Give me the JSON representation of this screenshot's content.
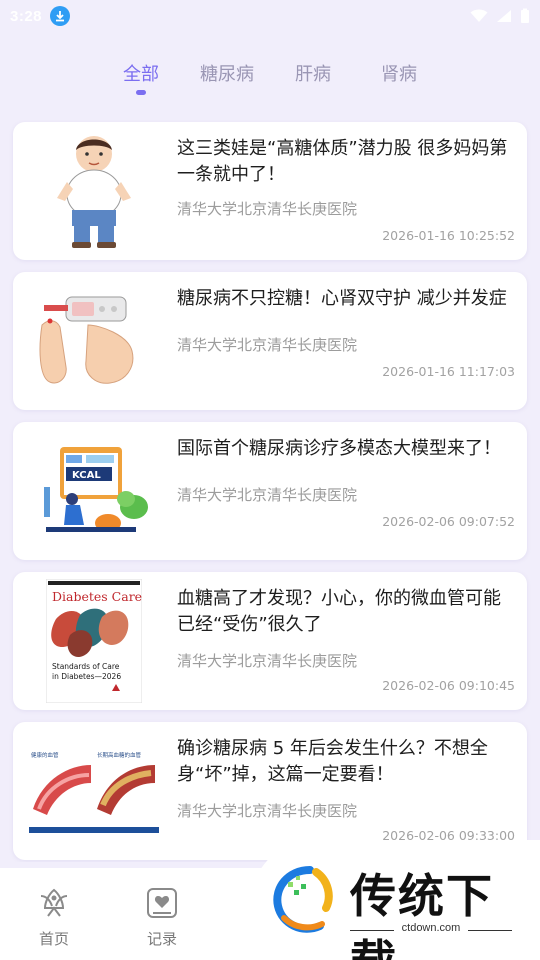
{
  "status_bar": {
    "time": "3:28"
  },
  "tabs": [
    {
      "label": "全部",
      "active": true
    },
    {
      "label": "糖尿病",
      "active": false
    },
    {
      "label": "肝病",
      "active": false
    },
    {
      "label": "肾病",
      "active": false
    }
  ],
  "articles": [
    {
      "title": "这三类娃是“高糖体质”潜力股 很多妈妈第一条就中了！",
      "source": "清华大学北京清华长庚医院",
      "time": "2026-01-16 10:25:52"
    },
    {
      "title": "糖尿病不只控糖！心肾双守护 减少并发症",
      "source": "清华大学北京清华长庚医院",
      "time": "2026-01-16 11:17:03"
    },
    {
      "title": "国际首个糖尿病诊疗多模态大模型来了！",
      "source": "清华大学北京清华长庚医院",
      "time": "2026-02-06 09:07:52"
    },
    {
      "title": "血糖高了才发现？小心，你的微血管可能已经“受伤”很久了",
      "source": "清华大学北京清华长庚医院",
      "time": "2026-02-06 09:10:45"
    },
    {
      "title": "确诊糖尿病 5 年后会发生什么？不想全身“坏”掉，这篇一定要看！",
      "source": "清华大学北京清华长庚医院",
      "time": "2026-02-06 09:33:00"
    }
  ],
  "thumbs": {
    "kcal": "KCAL",
    "journal_name": "Diabetes Care",
    "journal_sub1": "Standards of Care",
    "journal_sub2": "in Diabetes—2026",
    "vessel_left": "健康的血管",
    "vessel_right": "长期高血糖的血管"
  },
  "bottom_nav": [
    {
      "label": "首页",
      "icon": "home-icon"
    },
    {
      "label": "记录",
      "icon": "record-icon"
    }
  ],
  "watermark": {
    "text": "传统下载",
    "url": "ctdown.com"
  },
  "colors": {
    "accent": "#7b6ef0",
    "background": "#f1eefb",
    "inactive_tab": "#9a96b4"
  }
}
